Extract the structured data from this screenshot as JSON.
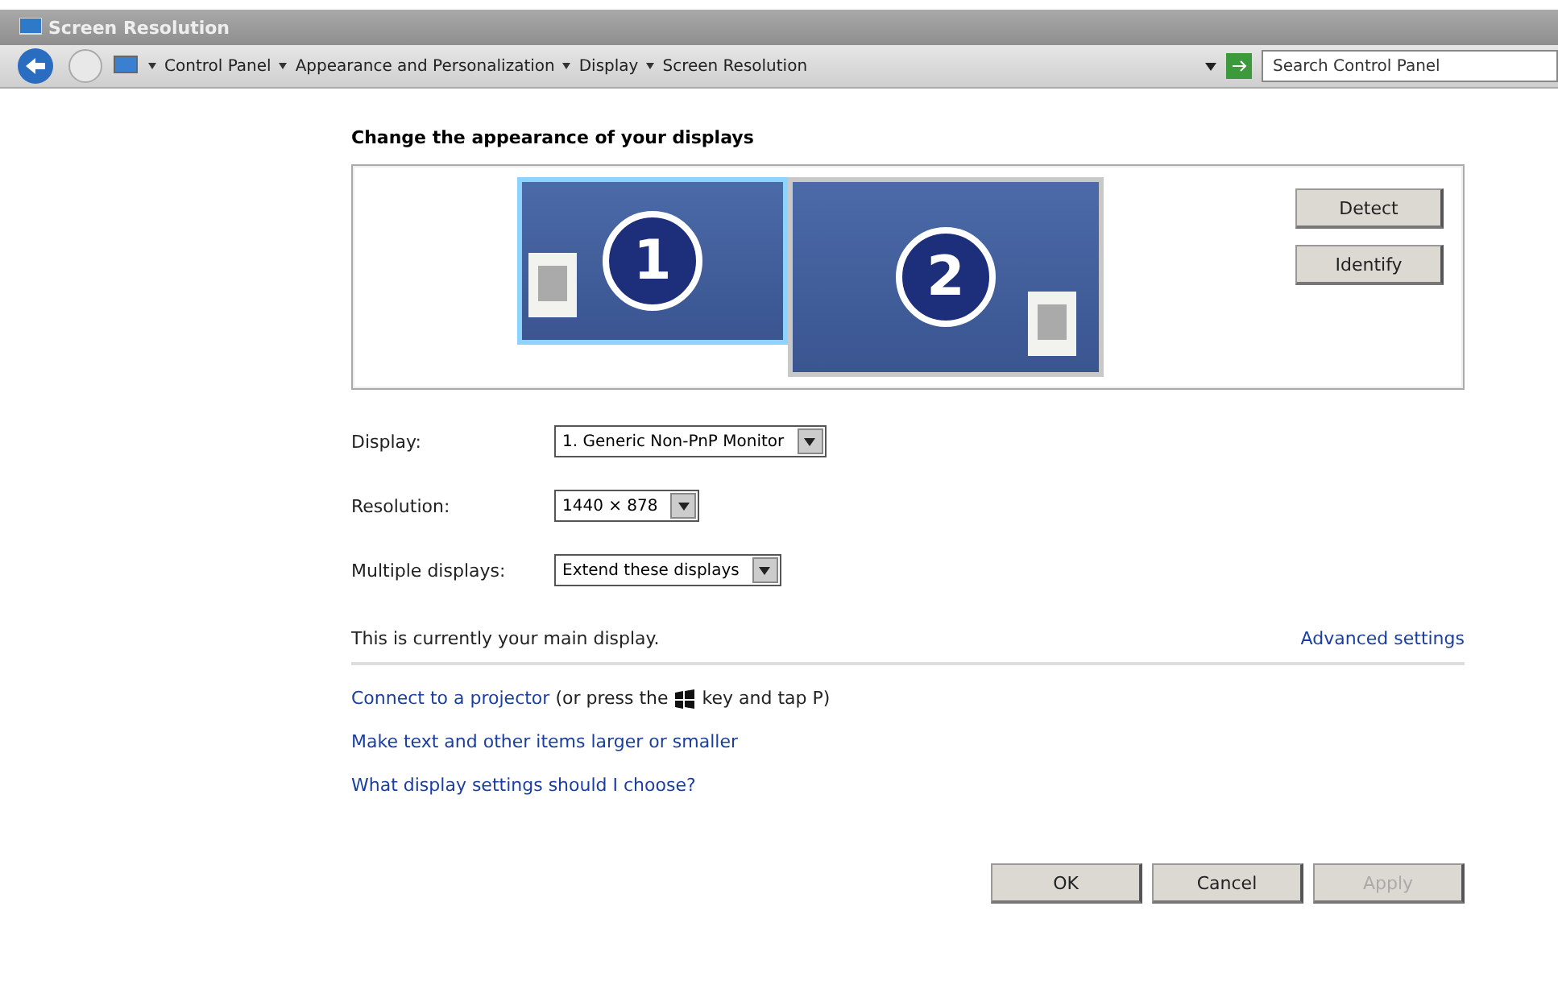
{
  "window": {
    "title": "Screen Resolution"
  },
  "breadcrumb": [
    "Control Panel",
    "Appearance and Personalization",
    "Display",
    "Screen Resolution"
  ],
  "search": {
    "placeholder": "Search Control Panel"
  },
  "heading": "Change the appearance of your displays",
  "monitors": [
    {
      "number": "1",
      "selected": true
    },
    {
      "number": "2",
      "selected": false
    }
  ],
  "side_buttons": [
    "Detect",
    "Identify"
  ],
  "settings": [
    {
      "label": "Display:",
      "value": "1. Generic Non-PnP Monitor"
    },
    {
      "label": "Resolution:",
      "value": "1440 × 878"
    },
    {
      "label": "Multiple displays:",
      "value": "Extend these displays"
    }
  ],
  "status": "This is currently your main display.",
  "advanced_link": "Advanced settings",
  "projector": {
    "link": "Connect to a projector",
    "before_key": "(or press the",
    "after_key": "key and tap P)"
  },
  "links": [
    "Make text and other items larger or smaller",
    "What display settings should I choose?"
  ],
  "buttons": [
    {
      "label": "OK",
      "disabled": false
    },
    {
      "label": "Cancel",
      "disabled": false
    },
    {
      "label": "Apply",
      "disabled": true
    }
  ]
}
